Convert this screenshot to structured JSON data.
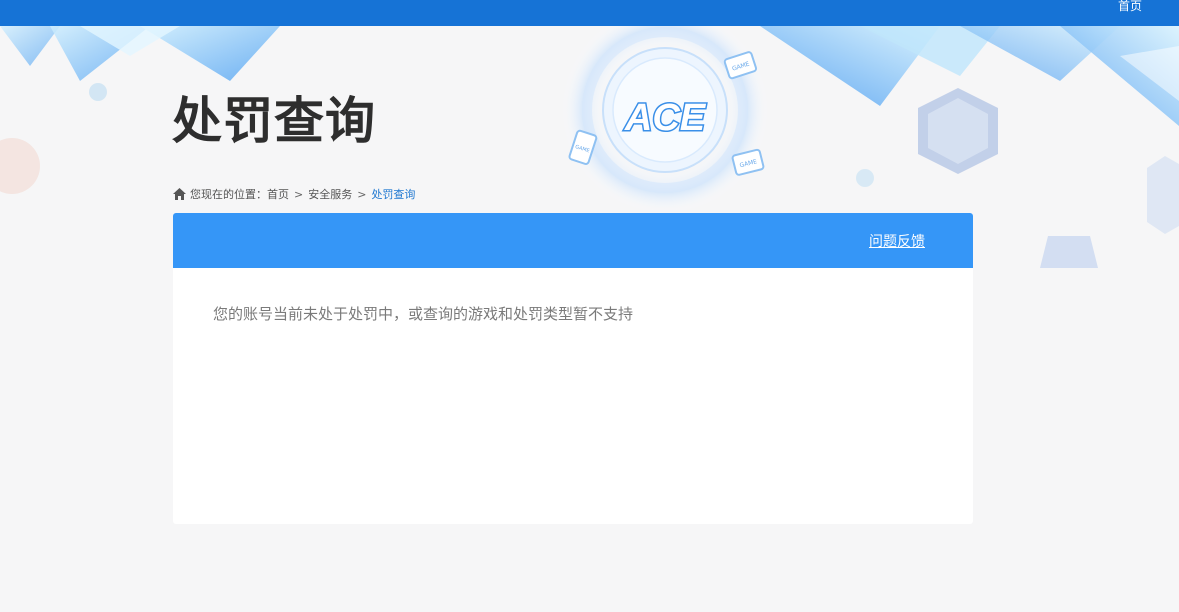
{
  "topbar": {
    "home_link": "首页"
  },
  "banner": {
    "logo_text": "ACE",
    "game_badge_text": "GAME"
  },
  "page": {
    "title": "处罚查询"
  },
  "breadcrumb": {
    "prefix": "您现在的位置：",
    "items": [
      "首页",
      "安全服务",
      "处罚查询"
    ],
    "separator": ">"
  },
  "panel": {
    "feedback_link": "问题反馈",
    "message": "您的账号当前未处于处罚中，或查询的游戏和处罚类型暂不支持"
  },
  "colors": {
    "topbar": "#1673d6",
    "panel_header": "#3596f7",
    "current_crumb": "#1e77d0",
    "background": "#f6f6f7"
  }
}
